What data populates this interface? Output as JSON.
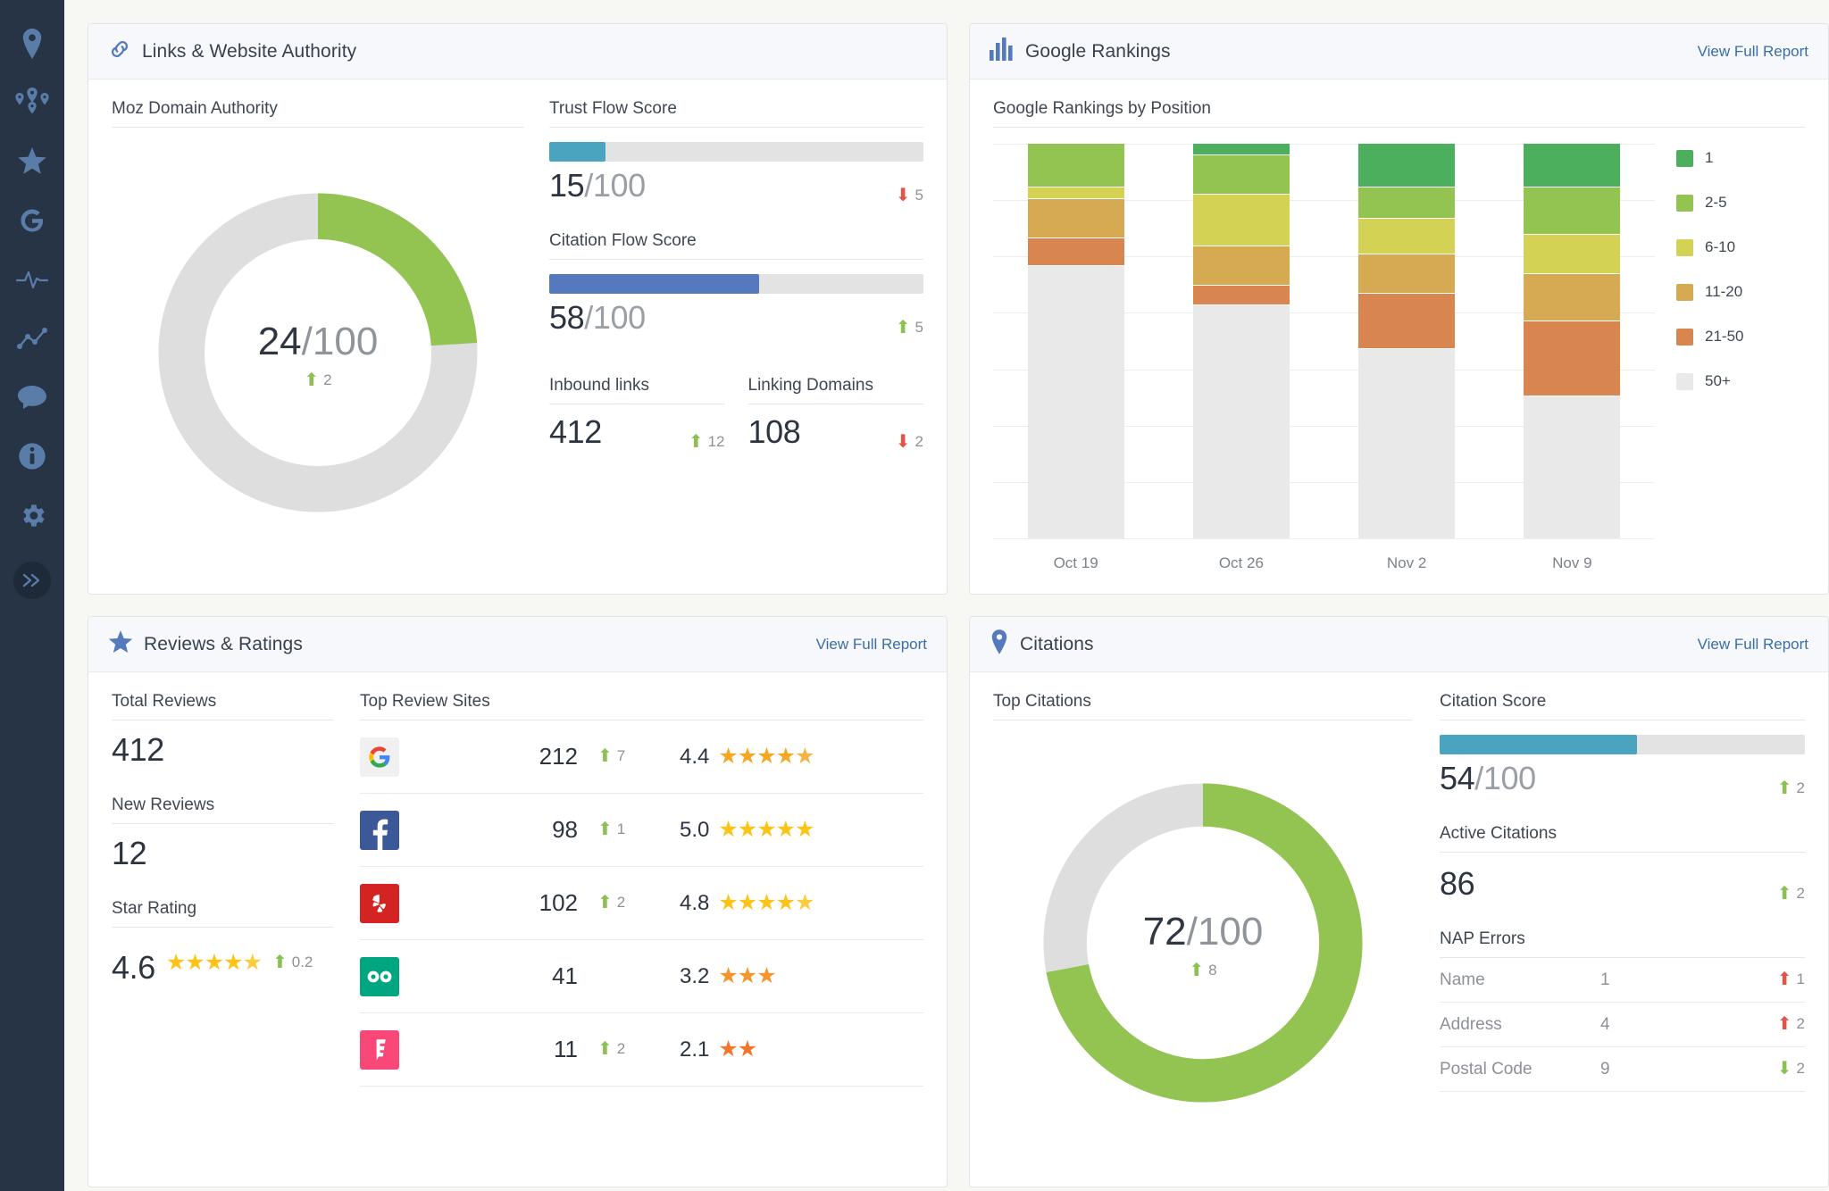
{
  "sidebar": {
    "items": [
      {
        "name": "location-pin-icon",
        "label": "Local"
      },
      {
        "name": "multi-location-icon",
        "label": "Locations"
      },
      {
        "name": "star-icon",
        "label": "Reviews"
      },
      {
        "name": "google-g-icon",
        "label": "Google"
      },
      {
        "name": "pulse-icon",
        "label": "Activity"
      },
      {
        "name": "trend-line-icon",
        "label": "Trends"
      },
      {
        "name": "speech-bubble-icon",
        "label": "Messages"
      },
      {
        "name": "info-circle-icon",
        "label": "Info"
      },
      {
        "name": "gear-icon",
        "label": "Settings"
      }
    ],
    "collapse": {
      "name": "expand-chevrons-icon",
      "label": "Expand"
    }
  },
  "links_card": {
    "title": "Links & Website Authority",
    "icon": "link-chain-icon",
    "moz": {
      "label": "Moz Domain Authority",
      "value": "24",
      "denominator": "/100",
      "percent": 24,
      "delta": "2",
      "delta_dir": "up"
    },
    "trust_flow": {
      "label": "Trust Flow Score",
      "value": "15",
      "denominator": "/100",
      "percent": 15,
      "delta": "5",
      "delta_dir": "down",
      "color": "#4aa3bf"
    },
    "citation_flow": {
      "label": "Citation Flow Score",
      "value": "58",
      "denominator": "/100",
      "percent": 56,
      "delta": "5",
      "delta_dir": "up",
      "color": "#5579bd"
    },
    "inbound_links": {
      "label": "Inbound links",
      "value": "412",
      "delta": "12",
      "delta_dir": "up"
    },
    "linking_domains": {
      "label": "Linking Domains",
      "value": "108",
      "delta": "2",
      "delta_dir": "down"
    }
  },
  "rankings_card": {
    "title": "Google Rankings",
    "icon": "bar-chart-icon",
    "view_report": "View Full Report",
    "chart_title": "Google Rankings by Position"
  },
  "chart_data": {
    "type": "bar",
    "title": "Google Rankings by Position",
    "stacked": true,
    "normalized": true,
    "xlabel": "",
    "ylabel": "",
    "grid": true,
    "legend_position": "right",
    "categories": [
      "Oct 19",
      "Oct 26",
      "Nov 2",
      "Nov 9"
    ],
    "series": [
      {
        "name": "1",
        "color": "#4caf5e",
        "values": [
          0,
          3,
          11,
          11
        ]
      },
      {
        "name": "2-5",
        "color": "#93c351",
        "values": [
          11,
          10,
          8,
          12
        ]
      },
      {
        "name": "6-10",
        "color": "#d3d254",
        "values": [
          3,
          13,
          9,
          10
        ]
      },
      {
        "name": "11-20",
        "color": "#d6a953",
        "values": [
          10,
          10,
          10,
          12
        ]
      },
      {
        "name": "21-50",
        "color": "#d8854f",
        "values": [
          7,
          5,
          14,
          19
        ]
      },
      {
        "name": "50+",
        "color": "#e9e9e9",
        "values": [
          69,
          59,
          48,
          36
        ]
      }
    ]
  },
  "reviews_card": {
    "title": "Reviews & Ratings",
    "icon": "star-icon",
    "view_report": "View Full Report",
    "total_reviews": {
      "label": "Total Reviews",
      "value": "412"
    },
    "new_reviews": {
      "label": "New Reviews",
      "value": "12"
    },
    "star_rating": {
      "label": "Star Rating",
      "value": "4.6",
      "stars": 4.6,
      "delta": "0.2",
      "delta_dir": "up"
    },
    "top_sites_label": "Top Review Sites",
    "sites": [
      {
        "icon": "google-logo-icon",
        "count": "212",
        "delta": "7",
        "delta_dir": "up",
        "rating": "4.4",
        "stars": 4.4,
        "star_color": "#f5a623"
      },
      {
        "icon": "facebook-logo-icon",
        "count": "98",
        "delta": "1",
        "delta_dir": "up",
        "rating": "5.0",
        "stars": 5.0,
        "star_color": "#fcc419"
      },
      {
        "icon": "yelp-logo-icon",
        "count": "102",
        "delta": "2",
        "delta_dir": "up",
        "rating": "4.8",
        "stars": 4.8,
        "star_color": "#fcc419"
      },
      {
        "icon": "tripadvisor-logo-icon",
        "count": "41",
        "delta": "",
        "delta_dir": "",
        "rating": "3.2",
        "stars": 3.0,
        "star_color": "#f5952b"
      },
      {
        "icon": "foursquare-logo-icon",
        "count": "11",
        "delta": "2",
        "delta_dir": "up",
        "rating": "2.1",
        "stars": 2.0,
        "star_color": "#f5752b"
      }
    ]
  },
  "citations_card": {
    "title": "Citations",
    "icon": "location-pin-icon",
    "view_report": "View Full Report",
    "top_citations_label": "Top Citations",
    "donut": {
      "value": "72",
      "denominator": "/100",
      "percent": 72,
      "delta": "8",
      "delta_dir": "up"
    },
    "citation_score": {
      "label": "Citation Score",
      "value": "54",
      "denominator": "/100",
      "percent": 54,
      "delta": "2",
      "delta_dir": "up",
      "color": "#4aa3bf"
    },
    "active_citations": {
      "label": "Active Citations",
      "value": "86",
      "delta": "2",
      "delta_dir": "up"
    },
    "nap_label": "NAP Errors",
    "nap_rows": [
      {
        "name": "Name",
        "value": "1",
        "delta": "1",
        "delta_dir": "up-bad"
      },
      {
        "name": "Address",
        "value": "4",
        "delta": "2",
        "delta_dir": "up-bad"
      },
      {
        "name": "Postal Code",
        "value": "9",
        "delta": "2",
        "delta_dir": "down-good"
      }
    ]
  },
  "colors": {
    "green": "#8cc152",
    "red": "#e0544a",
    "accent_blue": "#3a6ea8",
    "track": "#e3e3e3",
    "sidebar": "#263445"
  }
}
